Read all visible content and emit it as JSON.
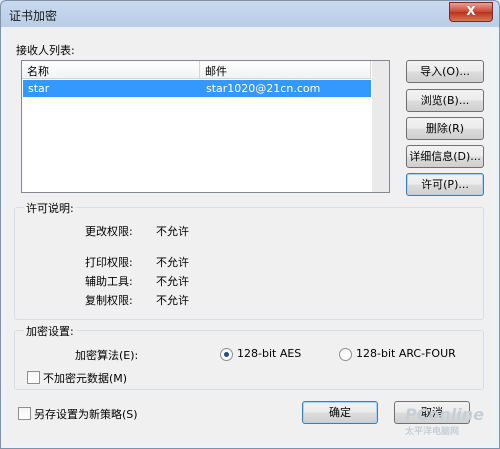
{
  "window": {
    "title": "证书加密",
    "close_glyph": "X"
  },
  "recipients": {
    "label": "接收人列表:",
    "columns": [
      "名称",
      "邮件"
    ],
    "rows": [
      {
        "name": "star",
        "email": "star1020@21cn.com",
        "selected": true
      }
    ]
  },
  "side_buttons": {
    "import": "导入(O)...",
    "browse": "浏览(B)...",
    "delete": "删除(R)",
    "details": "详细信息(D)...",
    "permit": "许可(P)..."
  },
  "permissions": {
    "title": "许可说明:",
    "items": [
      {
        "label": "更改权限:",
        "value": "不允许"
      },
      {
        "label": "打印权限:",
        "value": "不允许"
      },
      {
        "label": "辅助工具:",
        "value": "不允许"
      },
      {
        "label": "复制权限:",
        "value": "不允许"
      }
    ]
  },
  "encryption": {
    "title": "加密设置:",
    "algorithm_label": "加密算法(E):",
    "options": [
      "128-bit AES",
      "128-bit ARC-FOUR"
    ],
    "selected": "128-bit AES",
    "no_metadata_label": "不加密元数据(M)"
  },
  "footer": {
    "save_policy_label": "另存设置为新策略(S)",
    "ok": "确定",
    "cancel": "取消"
  },
  "watermark": {
    "brand": "PConline",
    "sub": "太平洋电脑网"
  },
  "colors": {
    "selection": "#3399ff",
    "title_bg": "#c9daef"
  }
}
